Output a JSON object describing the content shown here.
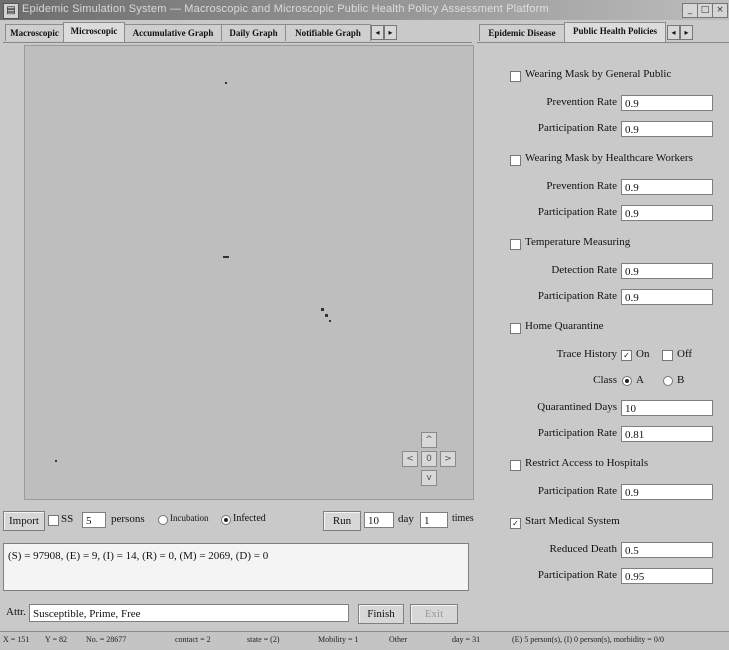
{
  "window": {
    "title": "Epidemic Simulation System — Macroscopic and Microscopic Public Health Policy Assessment Platform",
    "icon": "app-icon",
    "controls": [
      "_",
      "□",
      "×"
    ]
  },
  "left_tabs": {
    "items": [
      "Macroscopic",
      "Microscopic",
      "Accumulative Graph",
      "Daily Graph",
      "Notifiable Graph"
    ],
    "active": "Microscopic",
    "arrows": [
      "◂",
      "▸"
    ]
  },
  "canvas": {
    "nav": {
      "up": "^",
      "left": "<",
      "center": "0",
      "right": ">",
      "down": "v"
    }
  },
  "controls": {
    "import_label": "Import",
    "ss_label": "SS",
    "persons_value": "5",
    "persons_label": "persons",
    "incubation_label": "Incubation",
    "infected_label": "Infected",
    "run_label": "Run",
    "day_value": "10",
    "day_label": "day",
    "times_value": "1",
    "times_label": "times"
  },
  "output": {
    "line": "(S) = 97908, (E) = 9, (I) = 14, (R) = 0, (M) = 2069, (D) = 0"
  },
  "attribute": {
    "label": "Attr.",
    "value": "Susceptible, Prime, Free",
    "finish_label": "Finish",
    "exit_label": "Exit"
  },
  "status_bar": {
    "items": [
      "X = 151",
      "Y = 82",
      "No. = 28677",
      "contact = 2",
      "state = (2)",
      "Mobility = 1",
      "Other",
      "day = 31",
      "(E) 5 person(s), (I) 0 person(s), morbidity = 0/0"
    ]
  },
  "right_tabs": {
    "items": [
      "Epidemic Disease",
      "Public Health Policies"
    ],
    "active": "Public Health Policies",
    "arrows": [
      "◂",
      "▸"
    ]
  },
  "policies": {
    "mask_public": {
      "label": "Wearing Mask by General Public",
      "checked": false,
      "prevention_label": "Prevention Rate",
      "prevention_value": "0.9",
      "participation_label": "Participation Rate",
      "participation_value": "0.9"
    },
    "mask_hcw": {
      "label": "Wearing Mask by Healthcare Workers",
      "checked": false,
      "prevention_label": "Prevention Rate",
      "prevention_value": "0.9",
      "participation_label": "Participation Rate",
      "participation_value": "0.9"
    },
    "temperature": {
      "label": "Temperature Measuring",
      "checked": false,
      "detection_label": "Detection Rate",
      "detection_value": "0.9",
      "participation_label": "Participation Rate",
      "participation_value": "0.9"
    },
    "home_quarantine": {
      "label": "Home Quarantine",
      "checked": false,
      "trace_label": "Trace History",
      "on_label": "On",
      "off_label": "Off",
      "class_label": "Class",
      "a_label": "A",
      "b_label": "B",
      "days_label": "Quarantined Days",
      "days_value": "10",
      "participation_label": "Participation Rate",
      "participation_value": "0.81"
    },
    "restrict_hospitals": {
      "label": "Restrict Access to Hospitals",
      "checked": false,
      "participation_label": "Participation Rate",
      "participation_value": "0.9"
    },
    "medical_system": {
      "label": "Start Medical System",
      "checked": true,
      "reduced_label": "Reduced Death",
      "reduced_value": "0.5",
      "participation_label": "Participation Rate",
      "participation_value": "0.95"
    }
  }
}
